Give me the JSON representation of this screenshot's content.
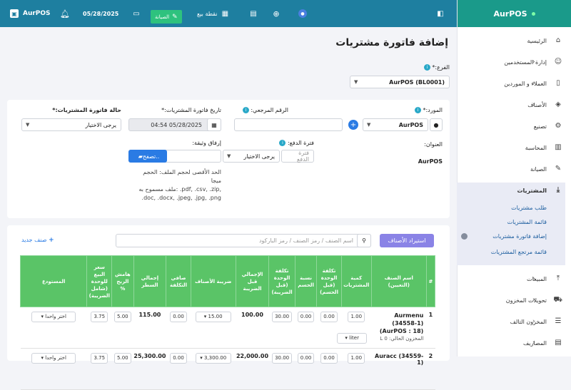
{
  "topbar": {
    "app_name": "AurPOS",
    "date": "05/28/2025",
    "maintenance_label": "الصيانة",
    "pos_label": "نقطة بيع"
  },
  "sidebar": {
    "brand": "AurPOS",
    "items": [
      {
        "label": "الرئيسية"
      },
      {
        "label": "إدارة المستخدمين"
      },
      {
        "label": "العملاء و الموردين"
      },
      {
        "label": "الأصناف"
      },
      {
        "label": "تصنيع"
      },
      {
        "label": "المحاسبة"
      },
      {
        "label": "الصيانة"
      },
      {
        "label": "المشتريات"
      },
      {
        "label": "المبيعات"
      },
      {
        "label": "تحويلات المخزون"
      },
      {
        "label": "المخزون التالف"
      },
      {
        "label": "المصاريف"
      }
    ],
    "purchases_sub": [
      {
        "label": "طلب مشتريات"
      },
      {
        "label": "قائمة المشتريات"
      },
      {
        "label": "إضافة فاتورة مشتريات"
      },
      {
        "label": "قائمة مرتجع المشتريات"
      }
    ]
  },
  "page": {
    "title": "إضافة فاتورة مشتريات",
    "branch_label": "الفرع:*",
    "branch_value": "AurPOS (BL0001)",
    "supplier_label": "المورد:*",
    "supplier_value": "AurPOS",
    "reference_label": "الرقم المرجعي:",
    "date_label": "تاريخ فاتورة المشتريات:*",
    "date_value": "05/28/2025 04:54",
    "status_label": "حالة فاتورة المشتريات:*",
    "status_value": "يرجى الاختيار",
    "address_label": "العنوان:",
    "address_value": "AurPOS",
    "pay_term_label": "فترة الدفع:",
    "pay_term_placeholder": "فترة الدفع",
    "pay_term_select": "يرجى الاختيار",
    "attach_label": "إرفاق وثيقة:",
    "browse_label": "تصفح..",
    "file_hint_1": "الحد الأقصى لحجم الملف: الحجم",
    "file_hint_2": "ميجا",
    "file_hint_3": "ملف مسموح به: .pdf, .csv, .zip,",
    "file_hint_4": ".doc, .docx, .jpeg, .jpg, .png",
    "import_button": "استيراد الأصناف",
    "search_placeholder": "اسم الصنف / رمز الصنف / رمز الباركود",
    "new_item_label": "صنف جديد"
  },
  "table": {
    "headers": [
      "#",
      "اسم الصنف (التعيين)",
      "كمية المشتريات",
      "تكلفة الوحدة (قبل الحسم)",
      "نسبة الحسم",
      "تكلفة الوحدة (قبل الضريبة)",
      "الإجمالي قبل الضريبة",
      "ضريبة الأصناف",
      "صافي التكلفة",
      "إجمالي السطر",
      "هامش الربح %",
      "سعر البيع للوحدة (شامل الضريبة)",
      "المستودع"
    ],
    "rows": [
      {
        "num": "1",
        "name": "Aurmenu (34558-1) (AurPOS : 18)",
        "stock": "المخزون الحالي: 0 L",
        "qty": "1.00",
        "unit": "liter",
        "cost_before_discount": "0.00",
        "discount": "0.00",
        "cost_before_tax": "30.00",
        "total_before_tax": "100.00",
        "tax": "15.00",
        "net_cost": "0.00",
        "line_total": "115.00",
        "margin": "5.00",
        "sell_price": "3.75",
        "warehouse": "اختر واحدا"
      },
      {
        "num": "2",
        "name": "Auracc (34559-1)",
        "qty": "1.00",
        "cost_before_discount": "0.00",
        "discount": "0.00",
        "cost_before_tax": "30.00",
        "total_before_tax": "22,000.00",
        "tax": "3,300.00",
        "net_cost": "0.00",
        "line_total": "25,300.00",
        "margin": "5.00",
        "sell_price": "3.75",
        "warehouse": "اختر واحدا"
      }
    ]
  }
}
